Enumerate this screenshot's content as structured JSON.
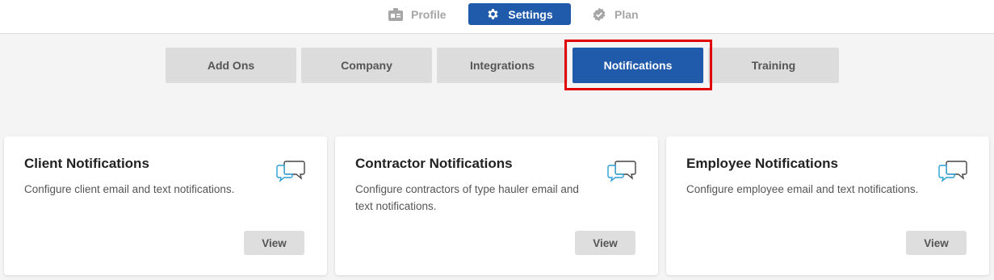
{
  "topnav": {
    "profile_label": "Profile",
    "settings_label": "Settings",
    "plan_label": "Plan"
  },
  "tabs": {
    "add_ons": "Add Ons",
    "company": "Company",
    "integrations": "Integrations",
    "notifications": "Notifications",
    "training": "Training",
    "active": "Notifications"
  },
  "cards": [
    {
      "title": "Client Notifications",
      "description": "Configure client email and text notifications.",
      "button": "View",
      "icon": "chat-bubbles-icon"
    },
    {
      "title": "Contractor Notifications",
      "description": "Configure contractors of type hauler email and text notifications.",
      "button": "View",
      "icon": "chat-bubbles-icon"
    },
    {
      "title": "Employee Notifications",
      "description": "Configure employee email and text notifications.",
      "button": "View",
      "icon": "chat-bubbles-icon"
    }
  ],
  "colors": {
    "primary": "#1f5aab",
    "highlight": "#e00000",
    "tab_bg": "#dcdcdc",
    "icon_accent": "#2a9fd6"
  }
}
